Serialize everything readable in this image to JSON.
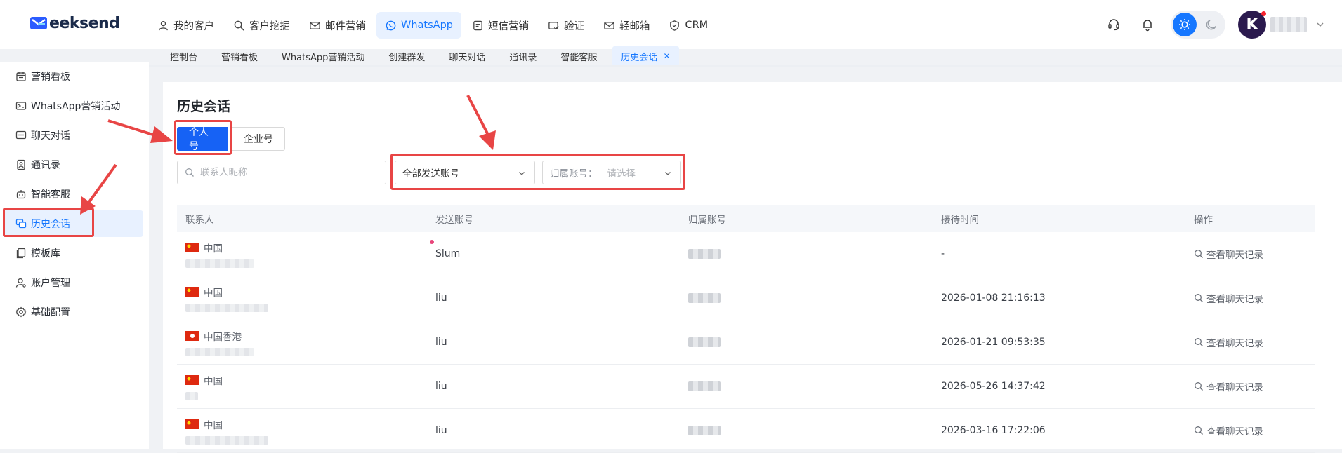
{
  "brand": {
    "name": "eeksend"
  },
  "topnav": [
    {
      "label": "我的客户",
      "icon": "user-icon"
    },
    {
      "label": "客户挖掘",
      "icon": "search-icon"
    },
    {
      "label": "邮件营销",
      "icon": "mail-icon"
    },
    {
      "label": "WhatsApp",
      "icon": "whatsapp-icon",
      "active": true
    },
    {
      "label": "短信营销",
      "icon": "sms-icon"
    },
    {
      "label": "验证",
      "icon": "verify-icon"
    },
    {
      "label": "轻邮箱",
      "icon": "light-mail-icon"
    },
    {
      "label": "CRM",
      "icon": "crm-icon"
    }
  ],
  "user": {
    "avatar_letter": "K"
  },
  "tabs": [
    "控制台",
    "营销看板",
    "WhatsApp营销活动",
    "创建群发",
    "聊天对话",
    "通讯录",
    "智能客服",
    "历史会话"
  ],
  "sidebar": [
    {
      "label": "营销看板",
      "icon": "calendar-icon"
    },
    {
      "label": "WhatsApp营销活动",
      "icon": "campaign-icon"
    },
    {
      "label": "聊天对话",
      "icon": "chat-icon"
    },
    {
      "label": "通讯录",
      "icon": "contacts-icon"
    },
    {
      "label": "智能客服",
      "icon": "robot-icon"
    },
    {
      "label": "历史会话",
      "icon": "history-icon",
      "active": true
    },
    {
      "label": "模板库",
      "icon": "template-icon"
    },
    {
      "label": "账户管理",
      "icon": "account-icon"
    },
    {
      "label": "基础配置",
      "icon": "settings-icon"
    }
  ],
  "page": {
    "title": "历史会话",
    "segments": [
      "个人号",
      "企业号"
    ],
    "search_placeholder": "联系人昵称",
    "send_account_select": "全部发送账号",
    "owner_label": "归属账号：",
    "owner_placeholder": "请选择"
  },
  "table": {
    "headers": [
      "联系人",
      "发送账号",
      "归属账号",
      "接待时间",
      "操作"
    ],
    "action_label": "查看聊天记录",
    "rows": [
      {
        "country": "中国",
        "flag": "cn",
        "send_account": "Slum",
        "time": "-"
      },
      {
        "country": "中国",
        "flag": "cn",
        "send_account": "liu",
        "time": "2026-01-08 21:16:13"
      },
      {
        "country": "中国香港",
        "flag": "hk",
        "send_account": "liu",
        "time": "2026-01-21 09:53:35"
      },
      {
        "country": "中国",
        "flag": "cn",
        "send_account": "liu",
        "time": "2026-05-26 14:37:42"
      },
      {
        "country": "中国",
        "flag": "cn",
        "send_account": "liu",
        "time": "2026-03-16 17:22:06"
      }
    ]
  },
  "colors": {
    "primary": "#1677ff",
    "annotation_red": "#e84545"
  }
}
